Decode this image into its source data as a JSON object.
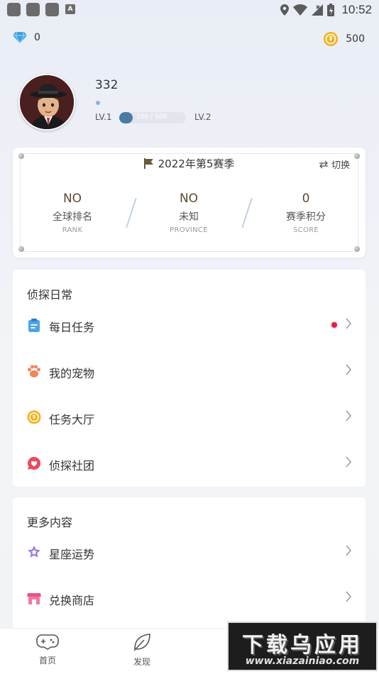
{
  "status_bar": {
    "time": "10:52",
    "icons": [
      "notification-icon",
      "notification-icon",
      "notification-icon",
      "keyboard-a-icon",
      "location-icon",
      "wifi-icon",
      "signal-icon",
      "battery-icon"
    ],
    "a_glyph": "A"
  },
  "currency": {
    "diamonds": "0",
    "coins": "500"
  },
  "profile": {
    "username": "332",
    "level_current": "LV.1",
    "level_next": "LV.2",
    "xp_text": "100 / 500",
    "xp_fraction": 0.2
  },
  "season": {
    "title": "2022年第5赛季",
    "switch_label": "切换",
    "stats": [
      {
        "value": "NO",
        "label": "全球排名",
        "sub": "RANK"
      },
      {
        "value": "NO",
        "label": "未知",
        "sub": "PROVINCE"
      },
      {
        "value": "0",
        "label": "赛季积分",
        "sub": "SCORE"
      }
    ]
  },
  "sections": [
    {
      "title": "侦探日常",
      "items": [
        {
          "label": "每日任务",
          "icon": "clipboard-icon",
          "badge": true
        },
        {
          "label": "我的宠物",
          "icon": "paw-icon",
          "badge": false
        },
        {
          "label": "任务大厅",
          "icon": "coin-icon",
          "badge": false
        },
        {
          "label": "侦探社团",
          "icon": "heart-chat-icon",
          "badge": false
        }
      ]
    },
    {
      "title": "更多内容",
      "items": [
        {
          "label": "星座运势",
          "icon": "star-icon",
          "badge": false
        },
        {
          "label": "兑换商店",
          "icon": "shop-icon",
          "badge": false
        }
      ]
    }
  ],
  "tabbar": {
    "tabs": [
      {
        "label": "首页",
        "icon": "gamepad-icon"
      },
      {
        "label": "发现",
        "icon": "leaf-icon"
      }
    ]
  },
  "watermark": {
    "big": "下载乌应用",
    "small": "www.xiazainiao.com"
  },
  "colors": {
    "accent": "#4a7aa6",
    "badge_red": "#d8234a",
    "gold": "#f3b31c"
  }
}
